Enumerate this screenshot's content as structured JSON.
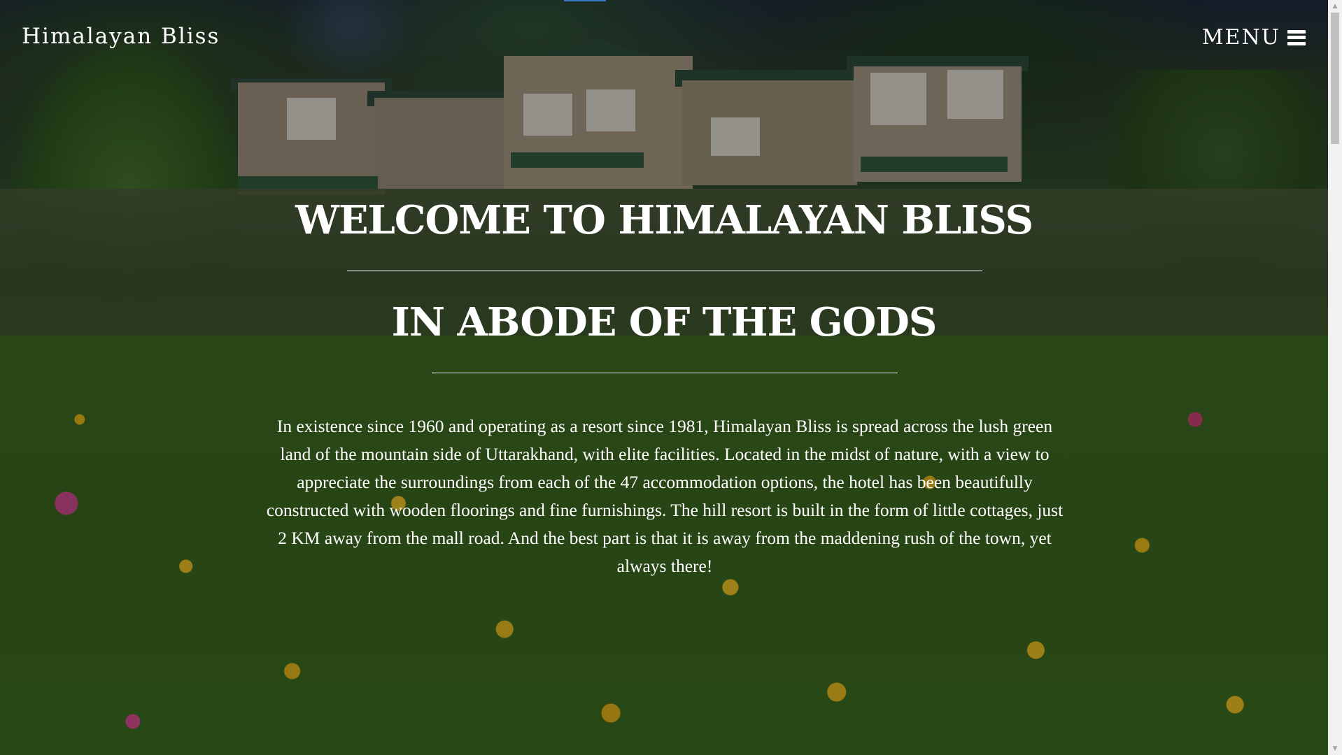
{
  "nav": {
    "brand": "Himalayan Bliss",
    "menu_label": "MENU",
    "menu_icon": "hamburger-icon"
  },
  "hero": {
    "title": "WELCOME TO HIMALAYAN BLISS",
    "subtitle": "IN ABODE OF THE GODS",
    "description": "In existence since 1960 and operating as a resort since 1981, Himalayan Bliss is spread across the lush green land of the mountain side of Uttarakhand, with elite facilities. Located in the midst of nature, with a view to appreciate the surroundings from each of the 47 accommodation options, the hotel has been beautifully constructed with wooden floorings and fine furnishings. The hill resort is built in the form of little cottages, just 2 KM away from the mall road. And the best part is that it is away from the maddening rush of the town, yet always there!"
  },
  "scrollbar": {
    "up_icon": "scroll-up-arrow-icon",
    "down_icon": "scroll-down-arrow-icon",
    "up_glyph": "▲",
    "down_glyph": "▼"
  },
  "colors": {
    "text": "#ffffff",
    "overlay": "rgba(0,0,0,0.32)",
    "scrollbar_track": "#f1f1f1",
    "scrollbar_thumb": "#c1c1c1"
  }
}
